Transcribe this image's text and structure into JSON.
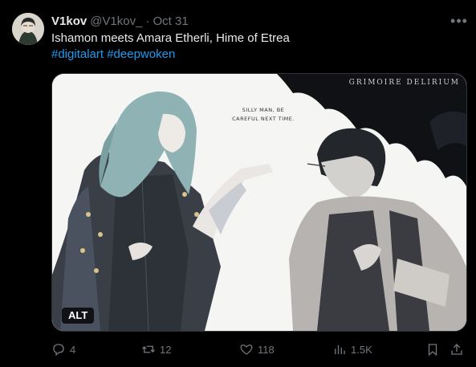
{
  "tweet": {
    "display_name": "V1kov",
    "handle": "@V1kov_",
    "separator": "·",
    "date": "Oct 31",
    "more_icon": "more-dots-icon",
    "text_line1": "Ishamon meets Amara Etherli, Hime of Etrea",
    "hashtag1": "#digitalart",
    "hashtag2": "#deepwoken"
  },
  "media": {
    "watermark": "GRIMOIRE DELIRIUM",
    "speech_line1": "SILLY MAN, BE",
    "speech_line2": "CAREFUL NEXT TIME.",
    "alt_label": "ALT"
  },
  "actions": {
    "reply_count": "4",
    "retweet_count": "12",
    "like_count": "118",
    "views_count": "1.5K",
    "reply_icon": "reply-icon",
    "retweet_icon": "retweet-icon",
    "like_icon": "heart-icon",
    "views_icon": "views-chart-icon",
    "bookmark_icon": "bookmark-icon",
    "share_icon": "share-icon"
  },
  "colors": {
    "background": "#000000",
    "text": "#e7e9ea",
    "muted": "#71767b",
    "link": "#1d9bf0"
  }
}
